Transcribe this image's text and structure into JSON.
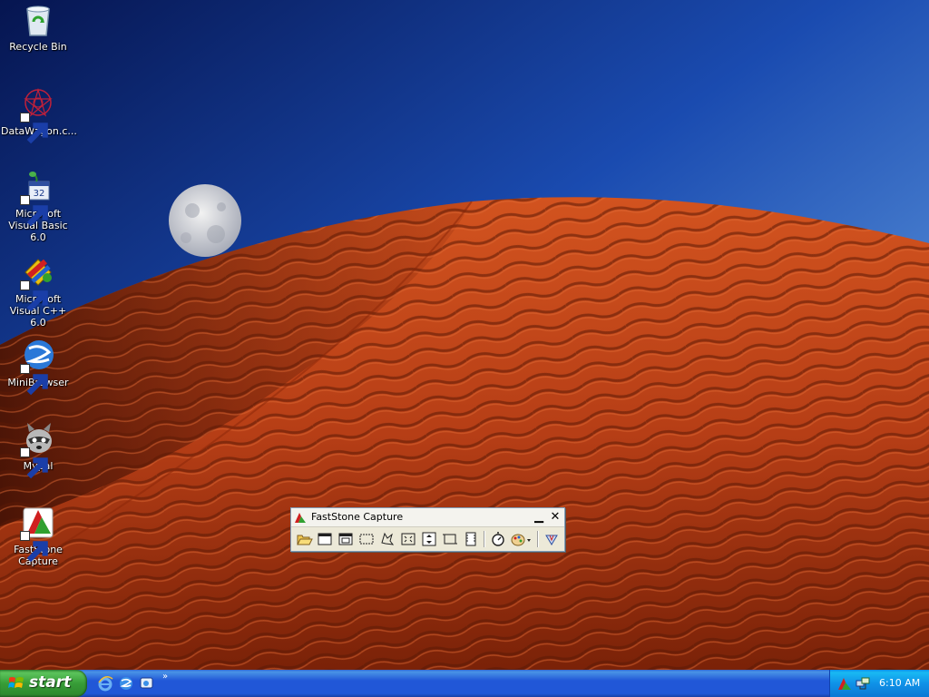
{
  "desktop": {
    "icons": [
      {
        "label": "Recycle Bin",
        "icon": "recycle-bin-icon"
      },
      {
        "label": "DataWagon.c...",
        "icon": "datawagon-icon"
      },
      {
        "label": "Microsoft Visual Basic 6.0",
        "icon": "visual-basic-icon"
      },
      {
        "label": "Microsoft Visual C++ 6.0",
        "icon": "visual-cpp-icon"
      },
      {
        "label": "MiniBrowser",
        "icon": "minibrowser-icon"
      },
      {
        "label": "Mypal",
        "icon": "mypal-icon"
      },
      {
        "label": "FastStone Capture",
        "icon": "faststone-capture-icon"
      }
    ]
  },
  "faststone": {
    "title": "FastStone Capture",
    "tools": [
      "open-file-icon",
      "capture-active-window-icon",
      "capture-window-object-icon",
      "capture-rectangle-icon",
      "capture-freehand-icon",
      "capture-fullscreen-icon",
      "capture-scrolling-window-icon",
      "capture-fixed-region-icon",
      "screen-recorder-icon",
      "delay-timer-icon",
      "output-destination-icon",
      "settings-menu-icon"
    ]
  },
  "taskbar": {
    "start_label": "start",
    "quick_launch": [
      "internet-explorer-icon",
      "minibrowser-quicklaunch-icon",
      "show-desktop-icon"
    ],
    "chevron": "»",
    "tray_icons": [
      "faststone-tray-icon",
      "network-tray-icon"
    ],
    "clock": "6:10 AM"
  },
  "colors": {
    "sky_top": "#0a1f63",
    "sky_bottom": "#6aa3e6",
    "dune": "#c4451c",
    "taskbar": "#2157d7",
    "start_green": "#3c9a3c"
  }
}
